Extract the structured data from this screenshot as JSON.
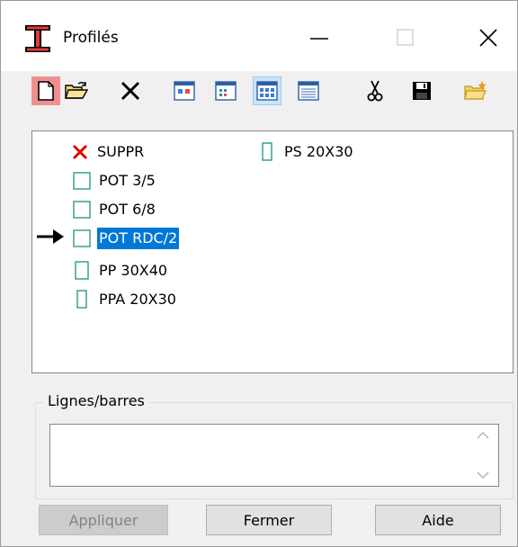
{
  "window": {
    "title": "Profilés",
    "icon": "i-beam-icon",
    "controls": [
      "minimize-icon",
      "maximize-icon",
      "close-icon"
    ]
  },
  "toolbar": {
    "items": [
      {
        "name": "new",
        "icon": "new-document-icon",
        "state": "pressed-red"
      },
      {
        "name": "open",
        "icon": "open-folder-icon"
      },
      {
        "name": "delete",
        "icon": "delete-x-icon"
      },
      {
        "name": "view-large",
        "icon": "view-large-icons-icon"
      },
      {
        "name": "view-small",
        "icon": "view-small-icons-icon"
      },
      {
        "name": "view-list",
        "icon": "view-list-icon",
        "state": "selected"
      },
      {
        "name": "view-details",
        "icon": "view-details-icon"
      },
      {
        "name": "cut",
        "icon": "scissors-icon"
      },
      {
        "name": "save",
        "icon": "save-disk-icon"
      },
      {
        "name": "new-folder",
        "icon": "new-folder-icon"
      }
    ]
  },
  "tree": {
    "items": [
      {
        "label": "SUPPR",
        "icon": "delete-red-x-icon"
      },
      {
        "label": "POT 3/5",
        "icon": "square-section-icon"
      },
      {
        "label": "POT 6/8",
        "icon": "square-section-icon"
      },
      {
        "label": "POT RDC/2",
        "icon": "square-section-icon",
        "selected": true,
        "current": true
      },
      {
        "label": "PP 30X40",
        "icon": "rect-section-icon"
      },
      {
        "label": "PPA 20X30",
        "icon": "narrow-rect-section-icon"
      },
      {
        "label": "PS 20X30",
        "icon": "narrow-rect-section-icon"
      }
    ],
    "current_marker_icon": "right-arrow-icon"
  },
  "group": {
    "legend": "Lignes/barres"
  },
  "buttons": {
    "apply": "Appliquer",
    "close": "Fermer",
    "help": "Aide"
  },
  "colors": {
    "selection": "#0078d7",
    "section_outline": "#2a9a8a",
    "delete_red": "#e00000",
    "pressed_red": "#f08f8f",
    "pressed_blue": "#cce4f7"
  }
}
